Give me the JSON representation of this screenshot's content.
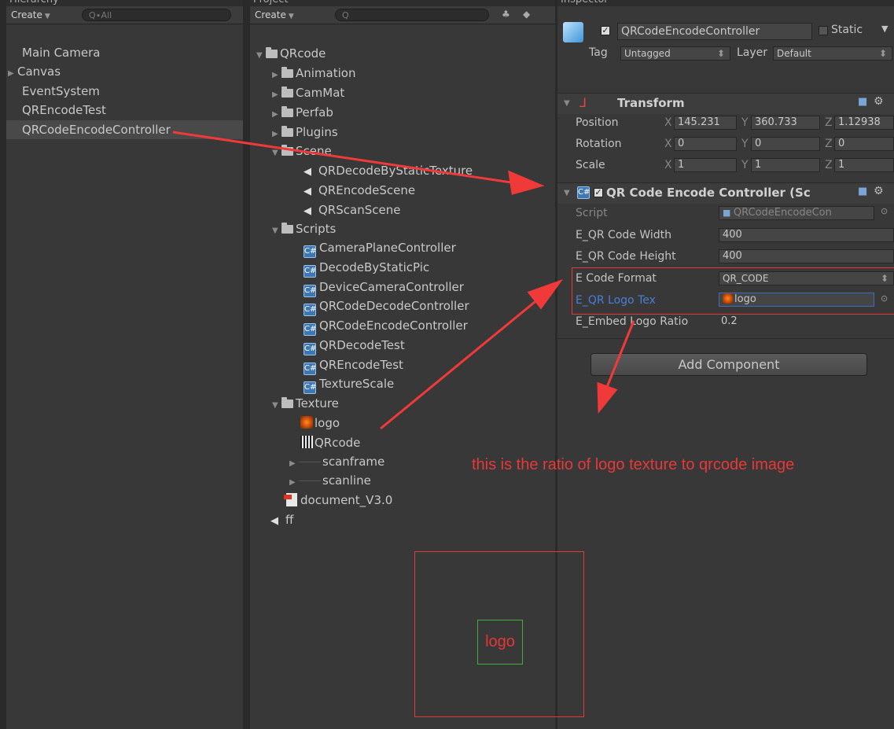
{
  "hierarchy": {
    "tab_label": "Hierarchy",
    "create_label": "Create",
    "search_placeholder": "Q∙All",
    "items": [
      "Main Camera",
      "Canvas",
      "EventSystem",
      "QREncodeTest",
      "QRCodeEncodeController"
    ]
  },
  "project": {
    "tab_label": "Project",
    "create_label": "Create",
    "search_placeholder": "Q",
    "root": "QRcode",
    "folders": [
      "Animation",
      "CamMat",
      "Perfab",
      "Plugins",
      "Scene",
      "Scripts",
      "Texture"
    ],
    "scenes": [
      "QRDecodeByStaticTexture",
      "QREncodeScene",
      "QRScanScene"
    ],
    "scripts": [
      "CameraPlaneController",
      "DecodeByStaticPic",
      "DeviceCameraController",
      "QRCodeDecodeController",
      "QRCodeEncodeController",
      "QRDecodeTest",
      "QREncodeTest",
      "TextureScale"
    ],
    "textures": [
      "logo",
      "QRcode",
      "scanframe",
      "scanline"
    ],
    "document": "document_V3.0",
    "scene_ff": "ff"
  },
  "inspector": {
    "tab_label": "Inspector",
    "object_name": "QRCodeEncodeController",
    "static_label": "Static",
    "tag_label": "Tag",
    "tag_value": "Untagged",
    "layer_label": "Layer",
    "layer_value": "Default",
    "transform": {
      "title": "Transform",
      "position_label": "Position",
      "rotation_label": "Rotation",
      "scale_label": "Scale",
      "axis_x": "X",
      "axis_y": "Y",
      "axis_z": "Z",
      "pos_x": "145.231",
      "pos_y": "360.733",
      "pos_z": "1.12938",
      "rot_x": "0",
      "rot_y": "0",
      "rot_z": "0",
      "scl_x": "1",
      "scl_y": "1",
      "scl_z": "1"
    },
    "component": {
      "title": "QR Code Encode Controller (Sc",
      "script_label": "Script",
      "script_value": "QRCodeEncodeCon",
      "width_label": "E_QR Code Width",
      "width_value": "400",
      "height_label": "E_QR Code Height",
      "height_value": "400",
      "format_label": "E Code Format",
      "format_value": "QR_CODE",
      "logo_label": "E_QR Logo Tex",
      "logo_value": "logo",
      "ratio_label": "E_Embed Logo Ratio",
      "ratio_value": "0.2"
    },
    "add_component_label": "Add Component"
  },
  "annotation": {
    "note": "this is the ratio of logo texture to qrcode image",
    "box_label": "logo",
    "color": "#e83838"
  }
}
